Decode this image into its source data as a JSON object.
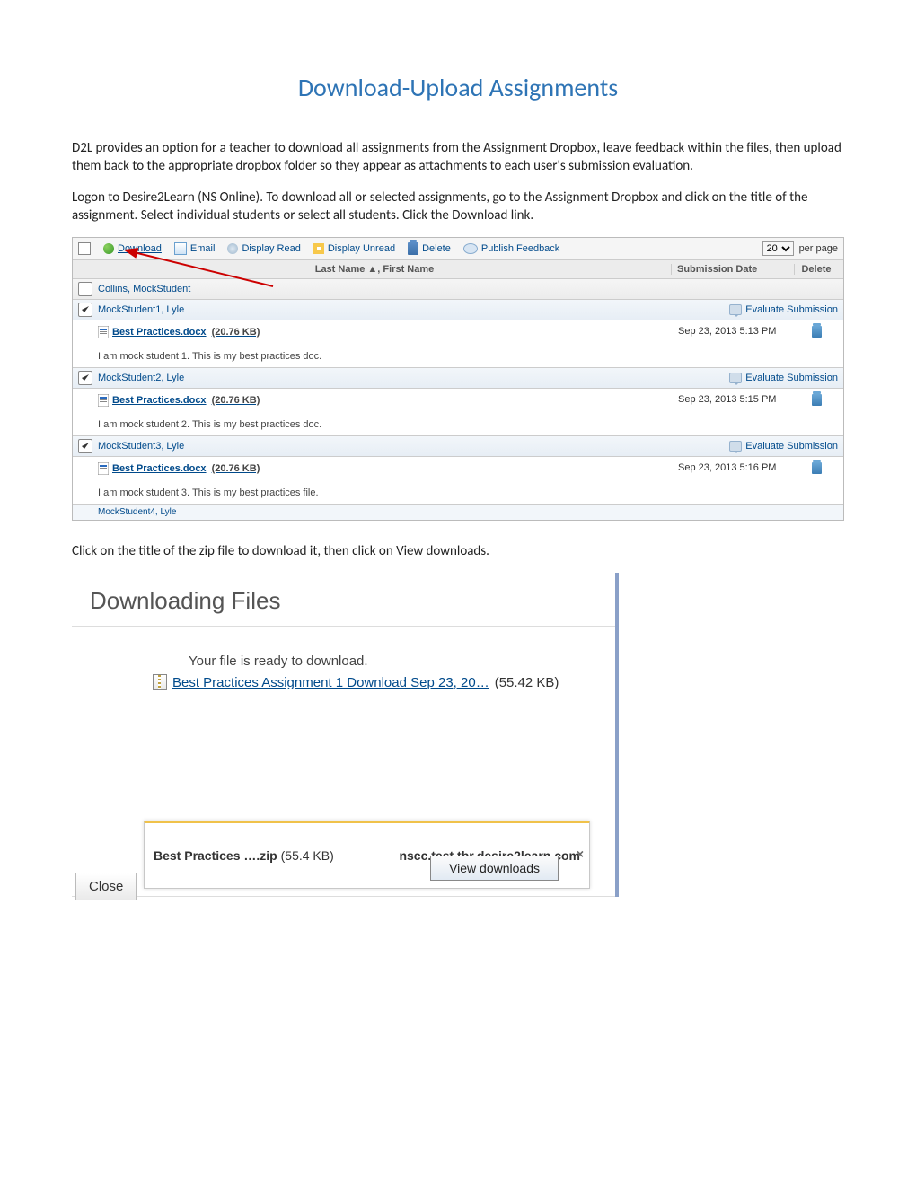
{
  "doc": {
    "title": "Download-Upload Assignments",
    "para1": "D2L provides an option for a teacher to download all assignments from the Assignment Dropbox, leave feedback within the files, then upload them back to the appropriate dropbox folder so they appear as attachments to each user's submission evaluation.",
    "para2": "Logon to Desire2Learn (NS Online). To download all or selected assignments, go to the Assignment Dropbox and click on the title of the assignment. Select individual students or select all students. Click the Download link.",
    "para3": "Click on the title of the zip file to download it, then click on View downloads."
  },
  "toolbar": {
    "download": "Download",
    "email": "Email",
    "display_read": "Display Read",
    "display_unread": "Display Unread",
    "delete": "Delete",
    "publish_feedback": "Publish Feedback",
    "per_page_value": "20",
    "per_page_label": "per page"
  },
  "columns": {
    "name": "Last Name ▲, First Name",
    "date": "Submission Date",
    "delete": "Delete"
  },
  "rows": [
    {
      "checked": false,
      "name": "Collins, MockStudent",
      "file": null,
      "date": "",
      "comment": "",
      "eval": false
    },
    {
      "checked": true,
      "name": "MockStudent1, Lyle",
      "file": "Best Practices.docx",
      "size": "(20.76 KB)",
      "date": "Sep 23, 2013 5:13 PM",
      "comment": "I am mock student 1. This is my best practices doc.",
      "eval": true
    },
    {
      "checked": true,
      "name": "MockStudent2, Lyle",
      "file": "Best Practices.docx",
      "size": "(20.76 KB)",
      "date": "Sep 23, 2013 5:15 PM",
      "comment": "I am mock student 2. This is my best practices doc.",
      "eval": true
    },
    {
      "checked": true,
      "name": "MockStudent3, Lyle",
      "file": "Best Practices.docx",
      "size": "(20.76 KB)",
      "date": "Sep 23, 2013 5:16 PM",
      "comment": "I am mock student 3. This is my best practices file.",
      "eval": true
    }
  ],
  "truncated_row": "MockStudent4, Lyle",
  "evaluate_label": "Evaluate Submission",
  "dl": {
    "heading": "Downloading Files",
    "ready": "Your file is ready to download.",
    "link": "Best Practices Assignment 1 Download Sep 23, 20…",
    "link_size": "(55.42 KB)",
    "ie_file": "Best Practices ….zip",
    "ie_size": "(55.4 KB)",
    "ie_host": "nscc.test.tbr.desire2learn.com",
    "ie_view": "View downloads",
    "close": "Close"
  }
}
